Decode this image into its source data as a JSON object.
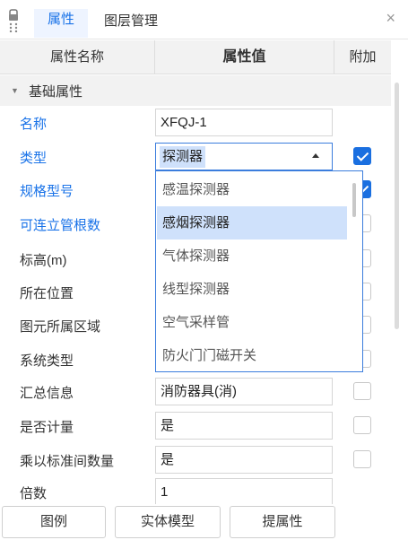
{
  "tabs": {
    "active": "属性",
    "inactive": "图层管理",
    "close": "×"
  },
  "columns": {
    "name": "属性名称",
    "value": "属性值",
    "extra": "附加"
  },
  "group": {
    "label": "基础属性"
  },
  "rows": [
    {
      "name": "名称",
      "value": "XFQJ-1"
    },
    {
      "name": "类型",
      "value": "探测器"
    },
    {
      "name": "规格型号"
    },
    {
      "name": "可连立管根数"
    },
    {
      "name": "标高(m)"
    },
    {
      "name": "所在位置"
    },
    {
      "name": "图元所属区域"
    },
    {
      "name": "系统类型"
    },
    {
      "name": "汇总信息",
      "value": "消防器具(消)"
    },
    {
      "name": "是否计量",
      "value": "是"
    },
    {
      "name": "乘以标准间数量",
      "value": "是"
    },
    {
      "name": "倍数",
      "value": "1"
    }
  ],
  "dropdown": {
    "options": [
      "感温探测器",
      "感烟探测器",
      "气体探测器",
      "线型探测器",
      "空气采样管",
      "防火门门磁开关"
    ],
    "highlighted": "感烟探测器"
  },
  "buttons": {
    "legend": "图例",
    "solid_model": "实体模型",
    "extract_props": "提属性"
  },
  "colors": {
    "accent": "#1a73e8",
    "highlight": "#cfe1fb",
    "checkbox_on": "#1a6fe0"
  }
}
